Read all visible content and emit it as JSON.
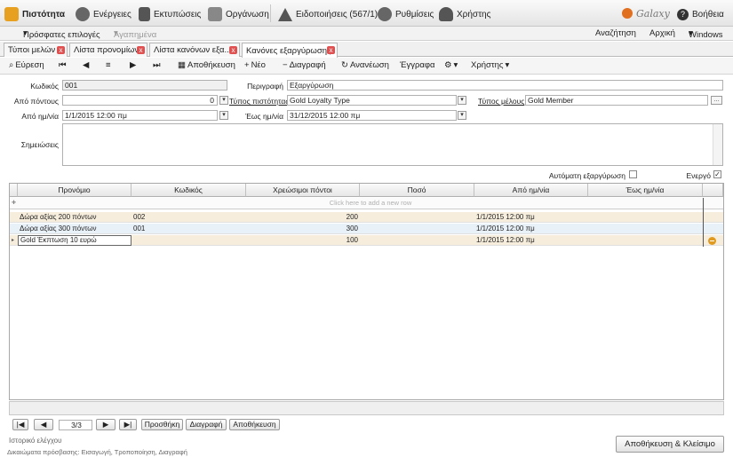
{
  "menu": {
    "loyalty": "Πιστότητα",
    "actions": "Ενέργειες",
    "prints": "Εκτυπώσεις",
    "organization": "Οργάνωση",
    "notifications": "Ειδοποιήσεις (567/1)",
    "settings": "Ρυθμίσεις",
    "user": "Χρήστης",
    "logo_text": "Galaxy",
    "help": "Βοήθεια"
  },
  "submenu": {
    "recent": "Πρόσφατες επιλογές",
    "favorites": "Αγαπημένα",
    "search": "Αναζήτηση",
    "home": "Αρχική",
    "windows": "Windows"
  },
  "tabs": [
    {
      "label": "Τύποι μελών"
    },
    {
      "label": "Λίστα προνομίων"
    },
    {
      "label": "Λίστα κανόνων εξα..."
    },
    {
      "label": "Κανόνες εξαργύρωσης"
    }
  ],
  "toolbar": {
    "find": "Εύρεση",
    "save": "Αποθήκευση",
    "new": "Νέο",
    "delete": "Διαγραφή",
    "refresh": "Ανανέωση",
    "documents": "Έγγραφα",
    "user": "Χρήστης"
  },
  "form": {
    "code_label": "Κωδικός",
    "code_value": "001",
    "desc_label": "Περιγραφή",
    "desc_value": "Εξαργύρωση",
    "from_points_label": "Από πόντους",
    "from_points_value": "0",
    "loyalty_type_label": "Τύπος πιστότητας",
    "loyalty_type_value": "Gold Loyalty Type",
    "member_type_label": "Τύπος μέλους",
    "member_type_value": "Gold Member",
    "from_date_label": "Από ημ/νία",
    "from_date_value": "1/1/2015 12:00 πμ",
    "to_date_label": "Έως ημ/νία",
    "to_date_value": "31/12/2015 12:00 πμ",
    "notes_label": "Σημειώσεις",
    "auto_redeem_label": "Αυτόματη εξαργύρωση",
    "active_label": "Ενεργό"
  },
  "grid": {
    "headers": [
      "Προνόμιο",
      "Κωδικός",
      "Χρεώσιμοι πόντοι",
      "Ποσό",
      "Από ημ/νία",
      "Έως ημ/νία"
    ],
    "new_row_hint": "Click here to add a new row",
    "rows": [
      {
        "c0": "Δώρα αξίας 200 πόντων",
        "c1": "002",
        "c2": "200",
        "c3": "",
        "c4": "1/1/2015 12:00 πμ",
        "c5": ""
      },
      {
        "c0": "Δώρα αξίας 300 πόντων",
        "c1": "001",
        "c2": "300",
        "c3": "",
        "c4": "1/1/2015 12:00 πμ",
        "c5": ""
      },
      {
        "c0": "Gold Έκπτωση 10 ευρώ",
        "c1": "",
        "c2": "100",
        "c3": "",
        "c4": "1/1/2015 12:00 πμ",
        "c5": ""
      }
    ]
  },
  "pager": {
    "position": "3/3",
    "add": "Προσθήκη",
    "delete": "Διαγραφή",
    "save": "Αποθήκευση"
  },
  "footer": {
    "history": "Ιστορικό ελέγχου",
    "rights": "Δικαιώματα πρόσβασης: Εισαγωγή, Τροποποίηση, Διαγραφή",
    "save_close": "Αποθήκευση & Κλείσιμο"
  },
  "colors": {
    "accent": "#f0a030",
    "row_highlight": "#f6eddc",
    "row_alt": "#e8f0f8"
  }
}
